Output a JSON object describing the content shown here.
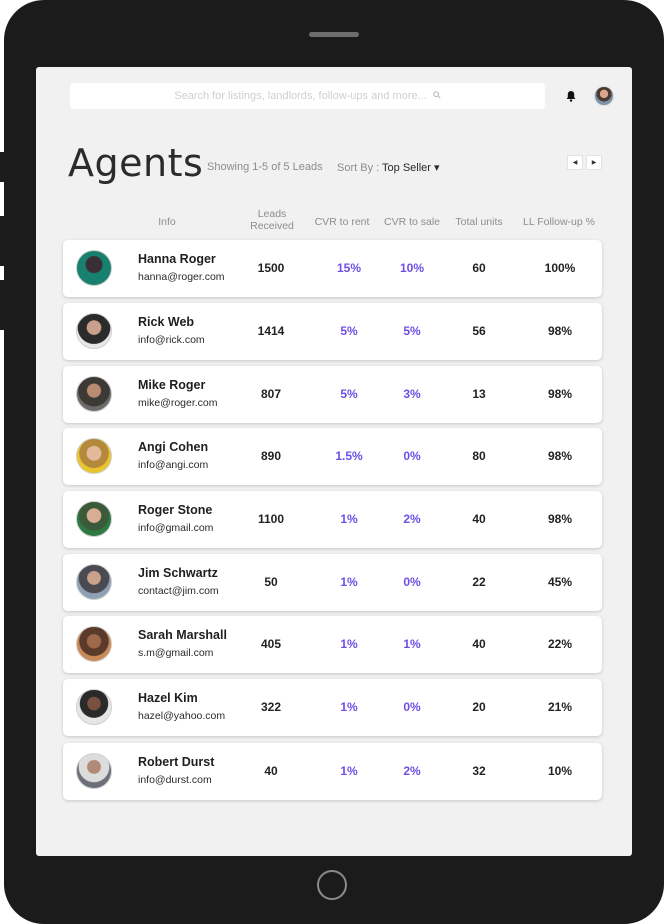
{
  "search": {
    "placeholder": "Search for listings, landlords, follow-ups and more..."
  },
  "page": {
    "title": "Agents",
    "showing": "Showing 1-5 of 5 Leads",
    "sort_label": "Sort By : ",
    "sort_value": "Top Seller ▾"
  },
  "columns": {
    "info": "Info",
    "leads": "Leads Received",
    "cvr_rent": "CVR to rent",
    "cvr_sale": "CVR to sale",
    "units": "Total units",
    "ll": "LL Follow-up %"
  },
  "colors": {
    "accent": "#6d4fe6"
  },
  "agents": [
    {
      "name": "Hanna Roger",
      "email": "hanna@roger.com",
      "leads": "1500",
      "cvr_rent": "15%",
      "cvr_sale": "10%",
      "units": "60",
      "ll": "100%"
    },
    {
      "name": "Rick Web",
      "email": "info@rick.com",
      "leads": "1414",
      "cvr_rent": "5%",
      "cvr_sale": "5%",
      "units": "56",
      "ll": "98%"
    },
    {
      "name": "Mike Roger",
      "email": "mike@roger.com",
      "leads": "807",
      "cvr_rent": "5%",
      "cvr_sale": "3%",
      "units": "13",
      "ll": "98%"
    },
    {
      "name": "Angi Cohen",
      "email": "info@angi.com",
      "leads": "890",
      "cvr_rent": "1.5%",
      "cvr_sale": "0%",
      "units": "80",
      "ll": "98%"
    },
    {
      "name": "Roger Stone",
      "email": "info@gmail.com",
      "leads": "1100",
      "cvr_rent": "1%",
      "cvr_sale": "2%",
      "units": "40",
      "ll": "98%"
    },
    {
      "name": "Jim Schwartz",
      "email": "contact@jim.com",
      "leads": "50",
      "cvr_rent": "1%",
      "cvr_sale": "0%",
      "units": "22",
      "ll": "45%"
    },
    {
      "name": "Sarah Marshall",
      "email": "s.m@gmail.com",
      "leads": "405",
      "cvr_rent": "1%",
      "cvr_sale": "1%",
      "units": "40",
      "ll": "22%"
    },
    {
      "name": "Hazel Kim",
      "email": "hazel@yahoo.com",
      "leads": "322",
      "cvr_rent": "1%",
      "cvr_sale": "0%",
      "units": "20",
      "ll": "21%"
    },
    {
      "name": "Robert Durst",
      "email": "info@durst.com",
      "leads": "40",
      "cvr_rent": "1%",
      "cvr_sale": "2%",
      "units": "32",
      "ll": "10%"
    }
  ]
}
